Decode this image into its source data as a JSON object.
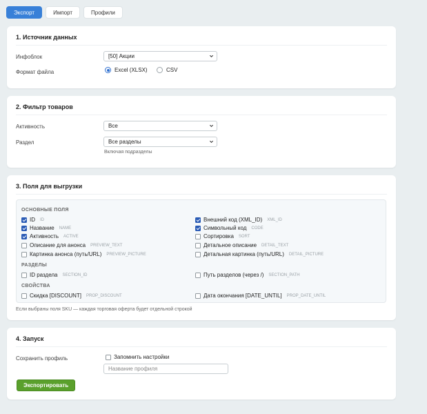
{
  "tabs": [
    {
      "label": "Экспорт",
      "active": true
    },
    {
      "label": "Импорт",
      "active": false
    },
    {
      "label": "Профили",
      "active": false
    }
  ],
  "source": {
    "title": "1. Источник данных",
    "iblock_label": "Инфоблок",
    "iblock_value": "[50] Акции",
    "format_label": "Формат файла",
    "format_options": [
      {
        "label": "Excel (XLSX)",
        "selected": true
      },
      {
        "label": "CSV",
        "selected": false
      }
    ]
  },
  "filter": {
    "title": "2. Фильтр товаров",
    "active_label": "Активность",
    "active_value": "Все",
    "section_label": "Раздел",
    "section_value": "Все разделы",
    "section_hint": "Включая подразделы"
  },
  "fields": {
    "title": "3. Поля для выгрузки",
    "groups": {
      "main": "ОСНОВНЫЕ ПОЛЯ",
      "sections": "РАЗДЕЛЫ",
      "props": "СВОЙСТВА"
    },
    "main_left": [
      {
        "label": "ID",
        "code": "ID",
        "checked": true
      },
      {
        "label": "Название",
        "code": "NAME",
        "checked": true
      },
      {
        "label": "Активность",
        "code": "ACTIVE",
        "checked": true
      },
      {
        "label": "Описание для анонса",
        "code": "PREVIEW_TEXT",
        "checked": false
      },
      {
        "label": "Картинка анонса (путь/URL)",
        "code": "PREVIEW_PICTURE",
        "checked": false
      }
    ],
    "main_right": [
      {
        "label": "Внешний код (XML_ID)",
        "code": "XML_ID",
        "checked": true
      },
      {
        "label": "Символьный код",
        "code": "CODE",
        "checked": true
      },
      {
        "label": "Сортировка",
        "code": "SORT",
        "checked": false
      },
      {
        "label": "Детальное описание",
        "code": "DETAIL_TEXT",
        "checked": false
      },
      {
        "label": "Детальная картинка (путь/URL)",
        "code": "DETAIL_PICTURE",
        "checked": false
      }
    ],
    "sections_left": {
      "label": "ID раздела",
      "code": "SECTION_ID",
      "checked": false
    },
    "sections_right": {
      "label": "Путь разделов (через /)",
      "code": "SECTION_PATH",
      "checked": false
    },
    "props_left": {
      "label": "Скидка [DISCOUNT]",
      "code": "PROP_DISCOUNT",
      "checked": false
    },
    "props_right": {
      "label": "Дата окончания [DATE_UNTIL]",
      "code": "PROP_DATE_UNTIL",
      "checked": false
    },
    "note": "Если выбраны поля SKU — каждая торговая оферта будет отдельной строкой"
  },
  "launch": {
    "title": "4. Запуск",
    "save_label": "Сохранить профиль",
    "remember_label": "Запомнить настройки",
    "remember_checked": false,
    "profile_placeholder": "Название профиля",
    "export_button": "Экспортировать"
  },
  "colors": {
    "accent": "#3880d8",
    "checkbox": "#2a5bb5",
    "export_button": "#5aa02c",
    "background": "#e9eef0"
  }
}
